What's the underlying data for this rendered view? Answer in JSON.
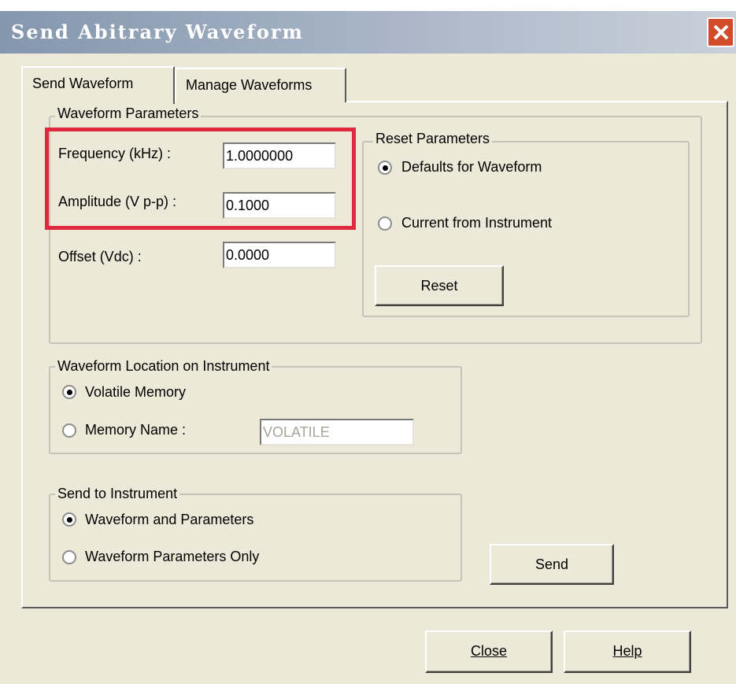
{
  "window": {
    "title": "Send Abitrary Waveform"
  },
  "tabs": [
    {
      "label": "Send Waveform",
      "selected": true
    },
    {
      "label": "Manage Waveforms",
      "selected": false
    }
  ],
  "waveform_parameters": {
    "label": "Waveform Parameters",
    "frequency": {
      "label": "Frequency (kHz) :",
      "value": "1.0000000"
    },
    "amplitude": {
      "label": "Amplitude (V p-p) :",
      "value": "0.1000"
    },
    "offset": {
      "label": "Offset (Vdc) :",
      "value": "0.0000"
    }
  },
  "reset_parameters": {
    "label": "Reset Parameters",
    "options": [
      {
        "label": "Defaults for Waveform",
        "selected": true
      },
      {
        "label": "Current from Instrument",
        "selected": false
      }
    ],
    "reset_button": "Reset"
  },
  "waveform_location": {
    "label": "Waveform Location on Instrument",
    "options": [
      {
        "label": "Volatile Memory",
        "selected": true
      },
      {
        "label": "Memory Name :",
        "selected": false
      }
    ],
    "memory_name_value": "VOLATILE"
  },
  "send_to_instrument": {
    "label": "Send to Instrument",
    "options": [
      {
        "label": "Waveform and Parameters",
        "selected": true
      },
      {
        "label": "Waveform Parameters Only",
        "selected": false
      }
    ]
  },
  "buttons": {
    "send": "Send",
    "close": "Close",
    "help": "Help"
  },
  "colors": {
    "highlight": "#e0293e",
    "dialog_bg": "#ece9d8"
  }
}
